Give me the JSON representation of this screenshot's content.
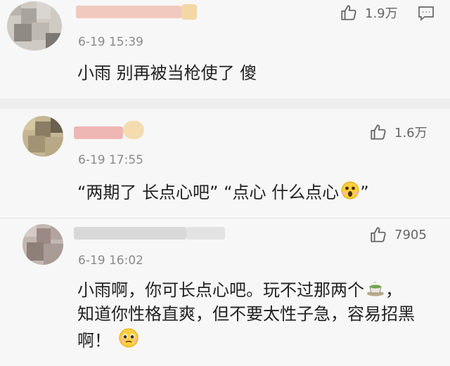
{
  "comments": [
    {
      "time": "6-19 15:39",
      "text": "小雨 别再被当枪使了 傻",
      "likes": "1.9万",
      "avatar_colors": [
        "#c9c6c2",
        "#8d8b88"
      ]
    },
    {
      "time": "6-19 17:55",
      "text_part1": "“两期了 长点心吧” “点心  什么点心",
      "text_part2": "”",
      "likes": "1.6万",
      "avatar_colors": [
        "#c2b18e",
        "#7b6f5a"
      ]
    },
    {
      "time": "6-19 16:02",
      "line1_text": "小雨啊，你可长点心吧。玩不过那两个",
      "line1_end": "，",
      "line2": "知道你性格直爽，但不要太性子急，容易招黑",
      "line3": "啊！",
      "likes": "7905",
      "avatar_colors": [
        "#bdb2aa",
        "#8e7e78"
      ]
    }
  ],
  "icons": {
    "like": "thumbs-up-icon",
    "reply": "comment-icon"
  },
  "colors": {
    "background": "#eeeeee",
    "card": "#f7f7f7",
    "time": "#8a8a8a",
    "text": "#222222",
    "icon": "#666666"
  }
}
